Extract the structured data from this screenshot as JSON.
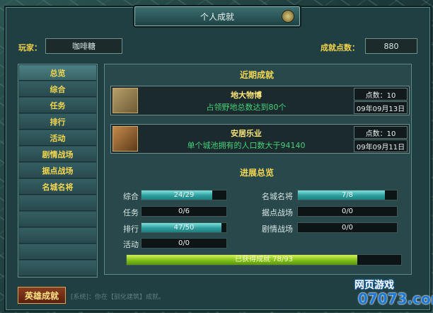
{
  "window": {
    "title": "个人成就"
  },
  "header": {
    "player_label": "玩家：",
    "player_name": "咖啡糖",
    "points_label": "成就点数：",
    "points_value": "880"
  },
  "sidebar": {
    "items": [
      {
        "label": "总览"
      },
      {
        "label": "综合"
      },
      {
        "label": "任务"
      },
      {
        "label": "排行"
      },
      {
        "label": "活动"
      },
      {
        "label": "剧情战场"
      },
      {
        "label": "据点战场"
      },
      {
        "label": "名城名将"
      }
    ]
  },
  "recent": {
    "heading": "近期成就",
    "items": [
      {
        "title": "地大物博",
        "desc": "占领野地总数达到80个",
        "points": "点数：10",
        "date": "09年09月13日",
        "icon": "farmland-icon"
      },
      {
        "title": "安居乐业",
        "desc": "单个城池拥有的人口数大于94140",
        "points": "点数：10",
        "date": "09年09月11日",
        "icon": "house-icon"
      }
    ]
  },
  "progress": {
    "heading": "进展总览",
    "left": [
      {
        "label": "综合",
        "text": "24/29",
        "fraction": 0.83
      },
      {
        "label": "任务",
        "text": "0/6",
        "fraction": 0
      },
      {
        "label": "排行",
        "text": "47/50",
        "fraction": 0.94
      },
      {
        "label": "活动",
        "text": "0/0",
        "fraction": 0
      }
    ],
    "right": [
      {
        "label": "名城名将",
        "text": "7/8",
        "fraction": 0.875
      },
      {
        "label": "据点战场",
        "text": "0/0",
        "fraction": 0
      },
      {
        "label": "剧情战场",
        "text": "0/0",
        "fraction": 0
      }
    ],
    "total": {
      "text": "已获得成就 78/93",
      "fraction": 0.84
    }
  },
  "footer": {
    "hero_button": "英雄成就",
    "note": "[系统]：你在【驯化建筑】成就。"
  },
  "watermark": {
    "line1": "网页游戏",
    "line2": "07073.com"
  }
}
